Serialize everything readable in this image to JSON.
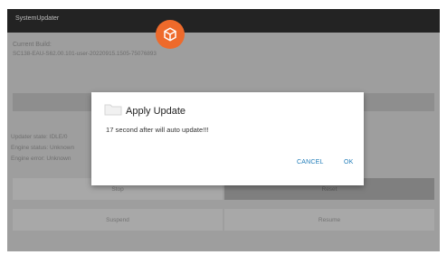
{
  "app": {
    "title": "SystemUpdater"
  },
  "build": {
    "label": "Current Build:",
    "value": "SC138-EAU-S62.00.101-user-20220915.1505-75076893"
  },
  "status": {
    "updater_state": "Updater state: IDLE/0",
    "engine_status": "Engine status: Unknown",
    "engine_error": "Engine error: Unknown"
  },
  "buttons": {
    "stop": "Stop",
    "reset": "Reset",
    "suspend": "Suspend",
    "resume": "Resume"
  },
  "dialog": {
    "title": "Apply Update",
    "message": "17 second after will auto update!!!",
    "cancel": "CANCEL",
    "ok": "OK"
  },
  "icons": {
    "badge": "package-box-icon",
    "badge_color": "#ee6a2b",
    "dialog_icon": "folder-icon"
  },
  "colors": {
    "appbar": "#232323",
    "accent": "#1e7bb8"
  }
}
